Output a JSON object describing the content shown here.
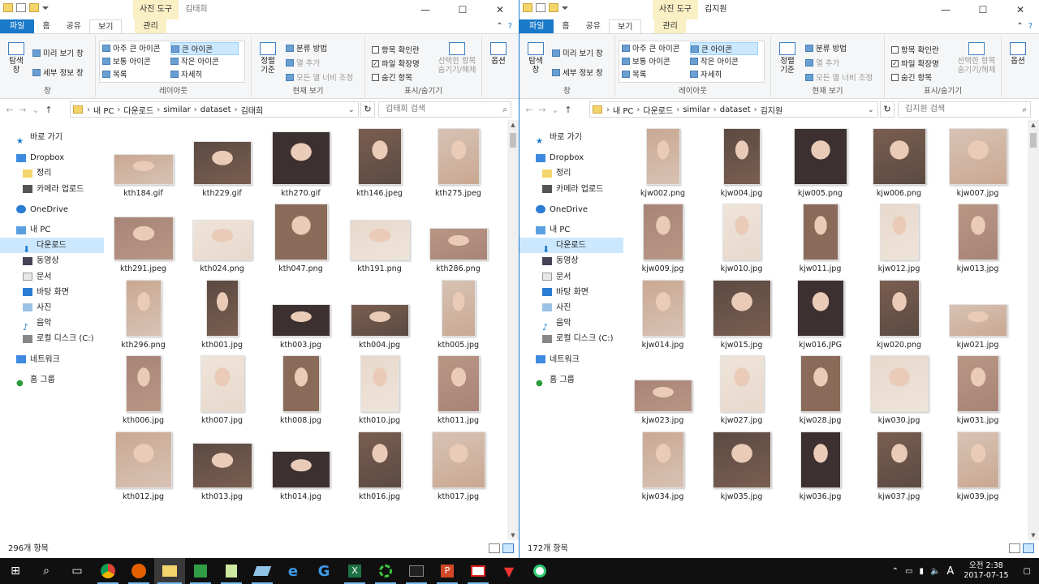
{
  "left": {
    "ctx_tab": "사진 도구",
    "title": "김태희",
    "tabs": [
      "파일",
      "홈",
      "공유",
      "보기",
      "관리"
    ],
    "ribbon": {
      "pane_nav": "탐색\n창",
      "preview": "미리 보기 창",
      "details": "세부 정보 창",
      "g_pane": "창",
      "l1": "아주 큰 아이콘",
      "l2": "큰 아이콘",
      "l3": "보통 아이콘",
      "l4": "작은 아이콘",
      "l5": "목록",
      "l6": "자세히",
      "g_layout": "레이아웃",
      "sort": "정렬\n기준",
      "groupby": "분류 방법",
      "addcol": "열 추가",
      "fitcol": "모든 열 너비 조정",
      "g_view": "현재 보기",
      "chk1": "항목 확인란",
      "chk2": "파일 확장명",
      "chk3": "숨긴 항목",
      "hide_sel": "선택한 항목\n숨기기/해제",
      "g_show": "표시/숨기기",
      "options": "옵션"
    },
    "crumbs": [
      "내 PC",
      "다운로드",
      "similar",
      "dataset",
      "김태희"
    ],
    "search": "김태희 검색",
    "nav": [
      "바로 가기",
      "Dropbox",
      "정리",
      "카메라 업로드",
      "OneDrive",
      "내 PC",
      "다운로드",
      "동영상",
      "문서",
      "바탕 화면",
      "사진",
      "음악",
      "로컬 디스크 (C:)",
      "네트워크",
      "홈 그룹"
    ],
    "files": [
      "kth184.gif",
      "kth229.gif",
      "kth270.gif",
      "kth146.jpeg",
      "kth275.jpeg",
      "kth291.jpeg",
      "kth024.png",
      "kth047.png",
      "kth191.png",
      "kth286.png",
      "kth296.png",
      "kth001.jpg",
      "kth003.jpg",
      "kth004.jpg",
      "kth005.jpg",
      "kth006.jpg",
      "kth007.jpg",
      "kth008.jpg",
      "kth010.jpg",
      "kth011.jpg",
      "kth012.jpg",
      "kth013.jpg",
      "kth014.jpg",
      "kth016.jpg",
      "kth017.jpg",
      "",
      "",
      "",
      "",
      ""
    ],
    "status": "296개 항목"
  },
  "right": {
    "ctx_tab": "사진 도구",
    "title": "김지원",
    "tabs": [
      "파일",
      "홈",
      "공유",
      "보기",
      "관리"
    ],
    "ribbon": {
      "pane_nav": "탐색\n창",
      "preview": "미리 보기 창",
      "details": "세부 정보 창",
      "g_pane": "창",
      "l1": "아주 큰 아이콘",
      "l2": "큰 아이콘",
      "l3": "보통 아이콘",
      "l4": "작은 아이콘",
      "l5": "목록",
      "l6": "자세히",
      "g_layout": "레이아웃",
      "sort": "정렬\n기준",
      "groupby": "분류 방법",
      "addcol": "열 추가",
      "fitcol": "모든 열 너비 조정",
      "g_view": "현재 보기",
      "chk1": "항목 확인란",
      "chk2": "파일 확장명",
      "chk3": "숨긴 항목",
      "hide_sel": "선택한 항목\n숨기기/해제",
      "g_show": "표시/숨기기",
      "options": "옵션"
    },
    "crumbs": [
      "내 PC",
      "다운로드",
      "similar",
      "dataset",
      "김지원"
    ],
    "search": "김지원 검색",
    "nav": [
      "바로 가기",
      "Dropbox",
      "정리",
      "카메라 업로드",
      "OneDrive",
      "내 PC",
      "다운로드",
      "동영상",
      "문서",
      "바탕 화면",
      "사진",
      "음악",
      "로컬 디스크 (C:)",
      "네트워크",
      "홈 그룹"
    ],
    "files": [
      "kjw002.png",
      "kjw004.jpg",
      "kjw005.png",
      "kjw006.png",
      "kjw007.jpg",
      "kjw009.jpg",
      "kjw010.jpg",
      "kjw011.jpg",
      "kjw012.jpg",
      "kjw013.jpg",
      "kjw014.jpg",
      "kjw015.jpg",
      "kjw016.JPG",
      "kjw020.png",
      "kjw021.jpg",
      "kjw023.jpg",
      "kjw027.jpg",
      "kjw028.jpg",
      "kjw030.jpg",
      "kjw031.jpg",
      "kjw034.jpg",
      "kjw035.jpg",
      "kjw036.jpg",
      "kjw037.jpg",
      "kjw039.jpg",
      "",
      "",
      "",
      "",
      ""
    ],
    "status": "172개 항목"
  },
  "taskbar": {
    "ime": "A",
    "time": "오전 2:38",
    "date": "2017-07-15",
    "icons": [
      "start-icon",
      "search-icon",
      "task-view-icon",
      "chrome-icon",
      "firefox-icon",
      "file-explorer-icon",
      "app-green-icon",
      "notepad-icon",
      "app-blue-icon",
      "edge-icon",
      "app-g-icon",
      "excel-icon",
      "app-ring-icon",
      "terminal-icon",
      "powerpoint-icon",
      "app-red-icon",
      "app-fox-icon",
      "app-circle-icon"
    ]
  },
  "colors": {
    "accent": "#1979ca",
    "selected": "#cce8ff",
    "context_tab": "#f9f0c5",
    "taskbar": "#101010"
  }
}
